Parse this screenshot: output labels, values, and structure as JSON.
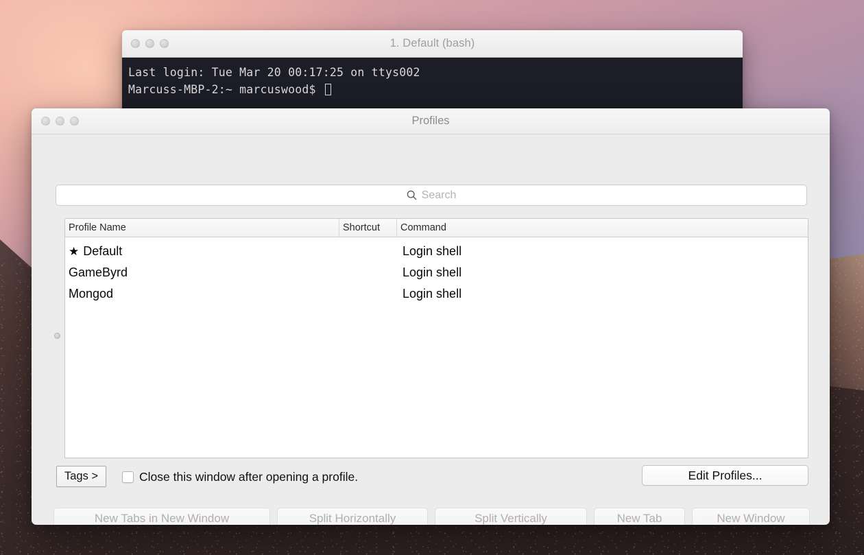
{
  "terminal": {
    "title": "1. Default (bash)",
    "traffic_lights": [
      "close",
      "minimize",
      "zoom"
    ],
    "lines": [
      "Last login: Tue Mar 20 00:17:25 on ttys002",
      "Marcuss-MBP-2:~ marcuswood$ "
    ],
    "background_color": "#1d1d28",
    "text_color": "#d8d8d8"
  },
  "profiles_window": {
    "title": "Profiles",
    "traffic_lights": [
      "close",
      "minimize",
      "zoom"
    ],
    "search": {
      "placeholder": "Search",
      "value": "",
      "icon": "search-icon"
    },
    "table": {
      "columns": [
        "Profile Name",
        "Shortcut",
        "Command"
      ],
      "rows": [
        {
          "star": "★",
          "name": "Default",
          "shortcut": "",
          "command": "Login shell"
        },
        {
          "star": "",
          "name": "GameByrd",
          "shortcut": "",
          "command": "Login shell"
        },
        {
          "star": "",
          "name": "Mongod",
          "shortcut": "",
          "command": "Login shell"
        }
      ]
    },
    "controls": {
      "tags_button": "Tags >",
      "close_after_checkbox_label": "Close this window after opening a profile.",
      "close_after_checked": false,
      "edit_profiles_button": "Edit Profiles..."
    },
    "actions": [
      {
        "label": "New Tabs in New Window",
        "enabled": false
      },
      {
        "label": "Split Horizontally",
        "enabled": false
      },
      {
        "label": "Split Vertically",
        "enabled": false
      },
      {
        "label": "New Tab",
        "enabled": false
      },
      {
        "label": "New Window",
        "enabled": false
      }
    ]
  },
  "colors": {
    "window_chrome": "#ececec",
    "table_background": "#ffffff",
    "disabled_text": "#b0aeae",
    "title_text": "#8d8d8d"
  }
}
